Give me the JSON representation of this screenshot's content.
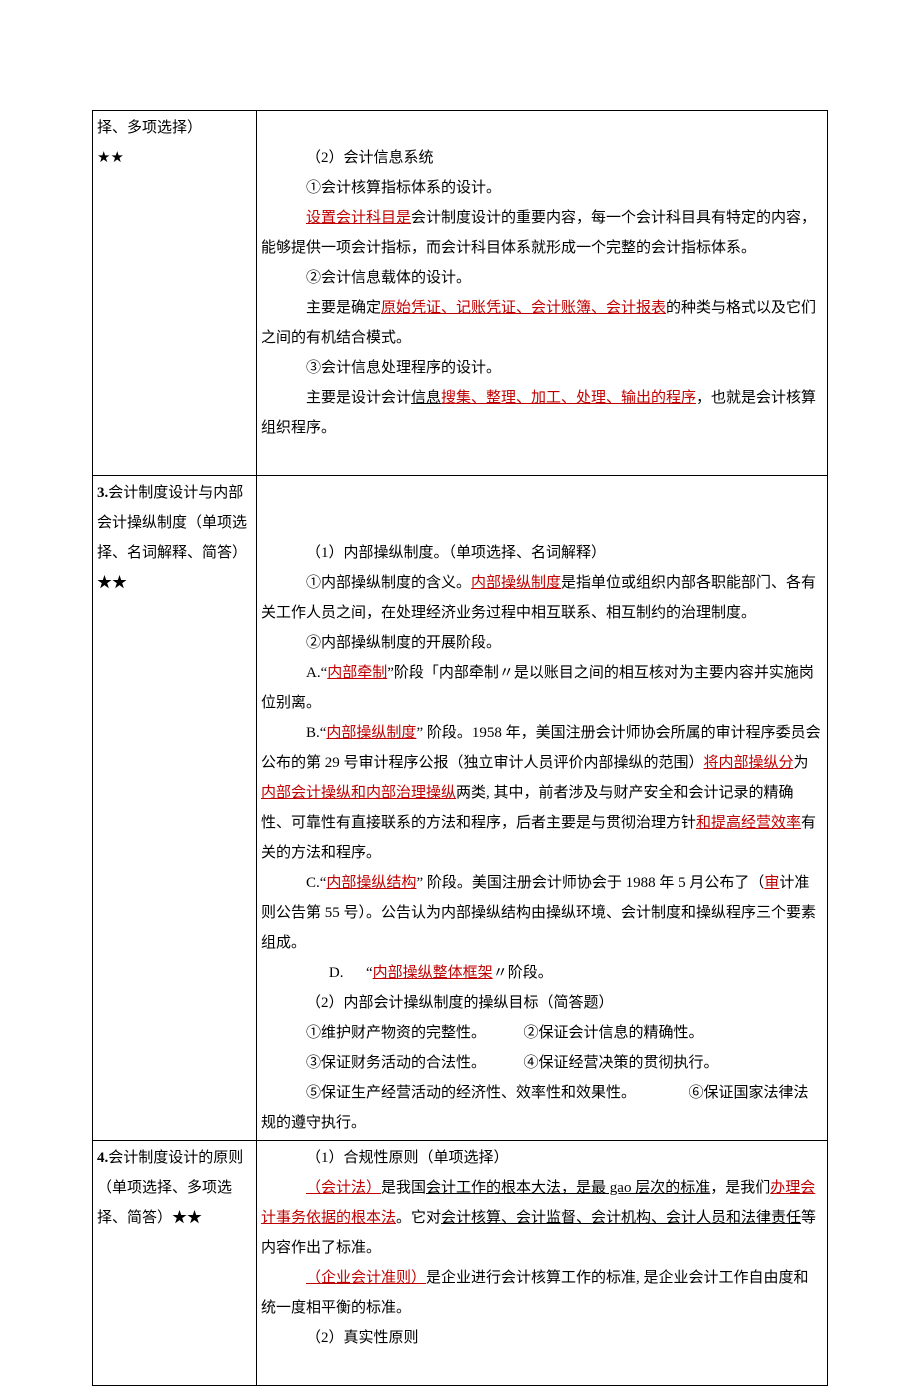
{
  "row2": {
    "left_l1": "择、多项选择）",
    "left_l2": "★★",
    "r1": "（2）会计信息系统",
    "r2": "①会计核算指标体系的设计。",
    "r3a": "设置会计科目是",
    "r3b": "会计制度设计的重要内容，每一个会计科目具有特定的内容，能够提供一项会计指标，而会计科目体系就形成一个完整的会计指标体系。",
    "r4": "②会计信息载体的设计。",
    "r5a": "主要是确定",
    "r5b": "原始凭证、记账凭证、会计账簿、会计报表",
    "r5c": "的种类与格式以及它们之间的有机结合模式。",
    "r6": "③会计信息处理程序的设计。",
    "r7a": "主要是设计会计",
    "r7b": "信息",
    "r7c": "搜集、整理、加工、处理、输出的程序",
    "r7d": "，也就是会计核算组织程序。"
  },
  "row3": {
    "left_l1": "3.",
    "left_l2": "会计制度设计与内部会计操纵制度（单项选择、名词解释、简答）",
    "left_l3": "★★",
    "r1": "（1）内部操纵制度。（单项选择、名词解释）",
    "r2a": "①内部操纵制度的含义。",
    "r2b": "内部操纵制度",
    "r2c": "是指单位或组织内部各职能部门、各有关工作人员之间，在处理经济业务过程中相互联系、相互制约的治理制度。",
    "r3": "②内部操纵制度的开展阶段。",
    "r4a": "A.“",
    "r4b": "内部牵制",
    "r4c": "”阶段「内部牵制〃是以账目之间的相互核对为主要内容并实施岗位别离。",
    "r5a": "B.“",
    "r5b": "内部操纵制度",
    "r5c": "” 阶段。1958 年，美国注册会计师协会所属的审计程序委员会公布的第 29 号审计程序公报（独立审计人员评价内部操纵的范围）",
    "r5d": "将内部操纵分",
    "r5e": "为",
    "r5f": "内部会计操纵和内部治理操纵",
    "r5g": "两类, 其中，前者涉及与财产安全和会计记录的精确性、可靠性有直接联系的方法和程序，后者主要是与贯彻治理方针",
    "r5h": "和提高经营效率",
    "r5i": "有关的方法和程序。",
    "r6a": "C.“",
    "r6b": "内部操纵结构",
    "r6c": "” 阶段。美国注册会计师协会于 1988 年 5 月公布了（",
    "r6d": "审",
    "r6e": "计准则公告第 55 号）。公告认为内部操纵结构由操纵环境、会计制度和操纵程序三个要素组成。",
    "r7a": "D.",
    "r7b": "“",
    "r7c": "内部操纵整体框架",
    "r7d": "〃阶段。",
    "r8": "（2）内部会计操纵制度的操纵目标（简答题）",
    "r9a": "①维护财产物资的完整性。",
    "r9b": "②保证会计信息的精确性。",
    "r10a": "③保证财务活动的合法性。",
    "r10b": "④保证经营决策的贯彻执行。",
    "r11a": "⑤保证生产经营活动的经济性、效率性和效果性。",
    "r11b": "⑥保证国家法律法规的遵守执行。"
  },
  "row4": {
    "left_l1": "4.",
    "left_l2": "会计制度设计的原则（单项选择、多项选择、简答）",
    "left_l3": "★★",
    "r1": "（1）合规性原则（单项选择）",
    "r2a": "（会计法）",
    "r2b": "是我国",
    "r2c": "会计工作的根本大法，是最 gao 层次的标准",
    "r2d": "，是我们",
    "r2e": "办理会计事务依据的根本法",
    "r2f": "。它对",
    "r2g": "会计核算、会计监督、会计机构、会计人员和法律责任",
    "r2h": "等内容作出了标准。",
    "r3a": "（企业会计准则）",
    "r3b": "是企业进行会计核算工作的标准, 是企业会计工作自由度和统一度相平衡的标准。",
    "r4": "（2）真实性原则"
  }
}
